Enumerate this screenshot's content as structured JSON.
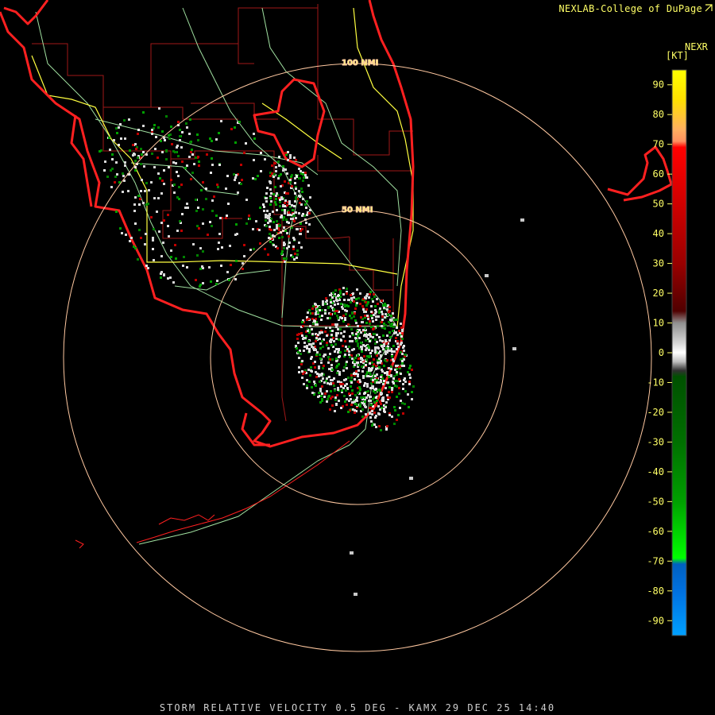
{
  "header": {
    "credit": "NEXLAB-College of DuPage",
    "product": "NEXR",
    "unit": "[KT]"
  },
  "footer": {
    "caption": "STORM RELATIVE VELOCITY 0.5 DEG - KAMX 29 DEC 25 14:40"
  },
  "range_rings": [
    {
      "label": "100 NMI",
      "nmi": 100
    },
    {
      "label": "50 NMI",
      "nmi": 50
    }
  ],
  "colorbar": {
    "ticks": [
      90,
      80,
      70,
      60,
      50,
      40,
      30,
      20,
      10,
      0,
      -10,
      -20,
      -30,
      -40,
      -50,
      -60,
      -70,
      -80,
      -90
    ],
    "range": [
      -95,
      95
    ],
    "stops": [
      {
        "v": 95,
        "c": "#ffff00"
      },
      {
        "v": 85,
        "c": "#ffe000"
      },
      {
        "v": 75,
        "c": "#ffb060"
      },
      {
        "v": 71,
        "c": "#ff9060"
      },
      {
        "v": 69,
        "c": "#ff0000"
      },
      {
        "v": 50,
        "c": "#d00000"
      },
      {
        "v": 30,
        "c": "#9a0000"
      },
      {
        "v": 14,
        "c": "#500000"
      },
      {
        "v": 10,
        "c": "#909090"
      },
      {
        "v": 3,
        "c": "#d8d8d8"
      },
      {
        "v": 0,
        "c": "#ffffff"
      },
      {
        "v": -3,
        "c": "#c0c0c0"
      },
      {
        "v": -6,
        "c": "#303030"
      },
      {
        "v": -8,
        "c": "#005000"
      },
      {
        "v": -30,
        "c": "#007000"
      },
      {
        "v": -50,
        "c": "#00a000"
      },
      {
        "v": -69,
        "c": "#00ff00"
      },
      {
        "v": -71,
        "c": "#0060c0"
      },
      {
        "v": -80,
        "c": "#0070e0"
      },
      {
        "v": -95,
        "c": "#00a0ff"
      }
    ]
  },
  "colors": {
    "coast": "#ff2020",
    "county": "#a01818",
    "road": "#a0e0a0",
    "interstate": "#ffff40",
    "ring": "#ffc8a0",
    "echo_gray": "#d8d8d8",
    "echo_green": "#00a000",
    "echo_red": "#c00000"
  }
}
